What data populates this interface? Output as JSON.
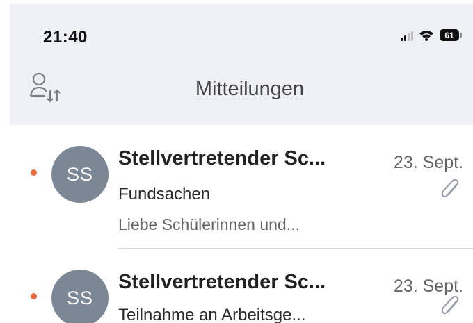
{
  "status_bar": {
    "time": "21:40",
    "battery": "61"
  },
  "header": {
    "title": "Mitteilungen",
    "sort_icon": "person-sort-icon"
  },
  "colors": {
    "unread": "#e8663a",
    "avatar": "#7b8794",
    "header_bg": "#eff0f5"
  },
  "messages": [
    {
      "initials": "SS",
      "sender": "Stellvertretender Sc...",
      "date": "23. Sept.",
      "subject": "Fundsachen",
      "preview": "Liebe Schülerinnen und...",
      "unread": true,
      "attachment": true
    },
    {
      "initials": "SS",
      "sender": "Stellvertretender Sc...",
      "date": "23. Sept.",
      "subject": "Teilnahme an Arbeitsge...",
      "preview": "",
      "unread": true,
      "attachment": true
    }
  ]
}
